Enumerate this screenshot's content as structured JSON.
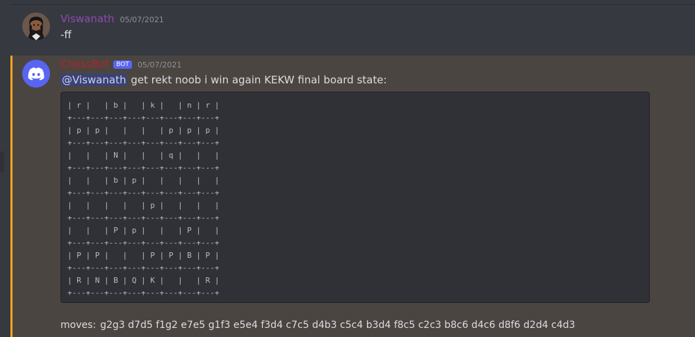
{
  "messages": {
    "first": {
      "username": "Viswanath",
      "timestamp": "05/07/2021",
      "content": "-ff",
      "avatar_icon": "anime-avatar-icon"
    },
    "second": {
      "username": "ChessBot",
      "bot_tag": "BOT",
      "timestamp": "05/07/2021",
      "mention": "@Viswanath",
      "content": "get rekt noob i win again KEKW final board state:",
      "avatar_icon": "discord-logo-icon",
      "board_lines": [
        "| r |   | b |   | k |   | n | r |",
        "+---+---+---+---+---+---+---+---+",
        "| p | p |   |   |   | p | p | p |",
        "+---+---+---+---+---+---+---+---+",
        "|   |   | N |   |   | q |   |   |",
        "+---+---+---+---+---+---+---+---+",
        "|   |   | b | p |   |   |   |   |",
        "+---+---+---+---+---+---+---+---+",
        "|   |   |   |   | p |   |   |   |",
        "+---+---+---+---+---+---+---+---+",
        "|   |   | P | p |   |   | P |   |",
        "+---+---+---+---+---+---+---+---+",
        "| P | P |   |   | P | P | B | P |",
        "+---+---+---+---+---+---+---+---+",
        "| R | N | B | Q | K |   |   | R |",
        "+---+---+---+---+---+---+---+---+"
      ],
      "moves_label": "moves:",
      "moves": "g2g3 d7d5 f1g2 e7e5 g1f3 e5e4 f3d4 c7c5 d4b3 c5c4 b3d4 f8c5 c2c3 b8c6 d4c6 d8f6 d2d4 c4d3"
    }
  },
  "colors": {
    "background": "#36393f",
    "highlight_bg": "#4b4542",
    "highlight_border": "#faa61a",
    "code_bg": "#2f3136",
    "bot_tag": "#5865f2",
    "viswanath_name": "#8e4bb3",
    "chessbot_name": "#ac2727"
  }
}
